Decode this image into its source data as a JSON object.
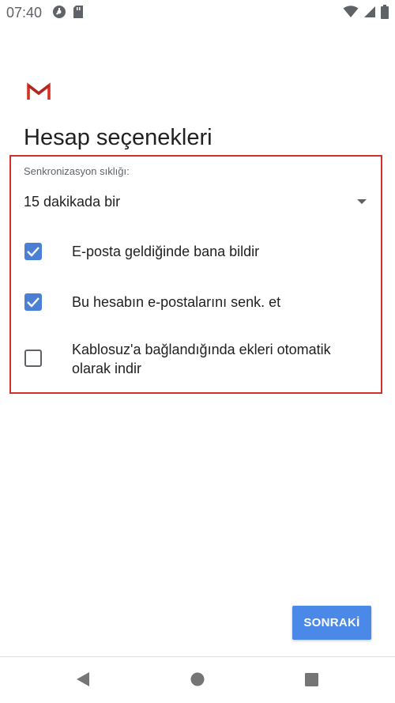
{
  "status_bar": {
    "time": "07:40",
    "left_icons": [
      "data-saver-icon",
      "sd-card-icon"
    ],
    "right_icons": [
      "wifi-icon",
      "signal-icon",
      "battery-icon"
    ]
  },
  "page": {
    "title": "Hesap seçenekleri"
  },
  "sync": {
    "label": "Senkronizasyon sıklığı:",
    "selected_value": "15 dakikada bir"
  },
  "options": [
    {
      "label": "E-posta geldiğinde bana bildir",
      "checked": true
    },
    {
      "label": "Bu hesabın e-postalarını senk. et",
      "checked": true
    },
    {
      "label": "Kablosuz'a bağlandığında ekleri otomatik olarak indir",
      "checked": false
    }
  ],
  "actions": {
    "next_label": "SONRAKİ"
  },
  "colors": {
    "accent": "#4a89e8",
    "checkbox": "#4a7fd4",
    "highlight_border": "#d32f2f",
    "gmail_red": "#d93025"
  },
  "nav": {
    "icons": [
      "back-icon",
      "home-icon",
      "recents-icon"
    ]
  }
}
